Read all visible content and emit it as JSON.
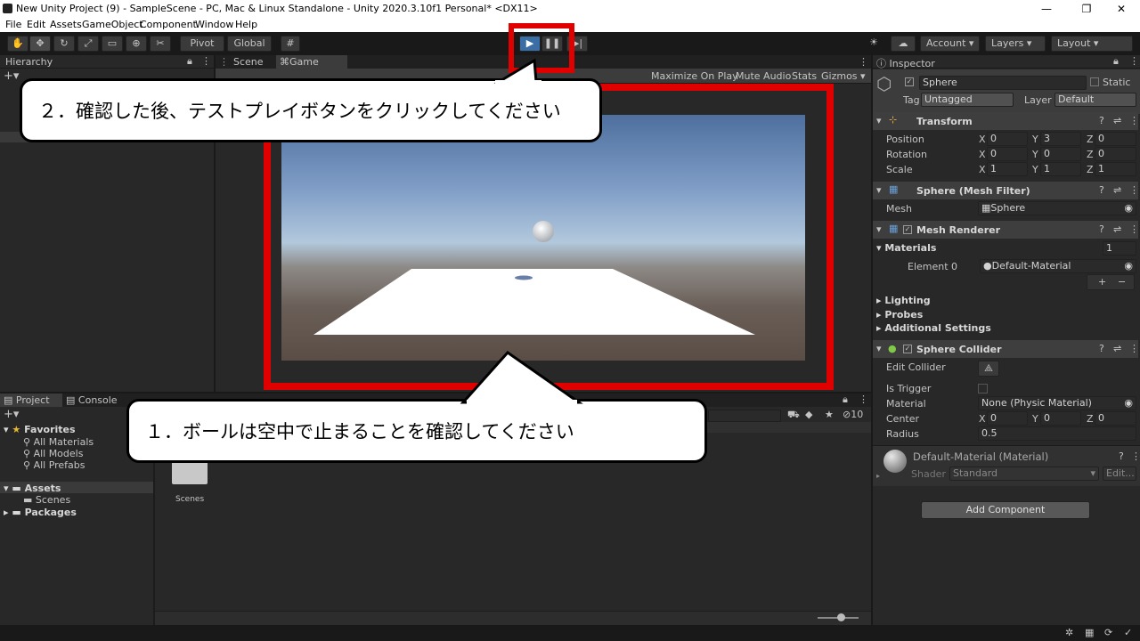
{
  "window": {
    "title": "New Unity Project (9) - SampleScene - PC, Mac & Linux Standalone - Unity 2020.3.10f1 Personal* <DX11>",
    "minimize": "—",
    "maximize": "❐",
    "close": "✕"
  },
  "menu": [
    "File",
    "Edit",
    "Assets",
    "GameObject",
    "Component",
    "Window",
    "Help"
  ],
  "toolbar": {
    "pivot": "Pivot",
    "global": "Global",
    "account": "Account",
    "layers": "Layers",
    "layout": "Layout"
  },
  "hierarchy": {
    "tab": "Hierarchy"
  },
  "scene_tabs": {
    "scene": "Scene",
    "game": "Game"
  },
  "game_toolbar": {
    "maximize": "Maximize On Play",
    "mute": "Mute Audio",
    "stats": "Stats",
    "gizmos": "Gizmos"
  },
  "project": {
    "tab_project": "Project",
    "tab_console": "Console",
    "favorites": "Favorites",
    "fav_items": [
      "All Materials",
      "All Models",
      "All Prefabs"
    ],
    "assets": "Assets",
    "scenes": "Scenes",
    "packages": "Packages",
    "folder_label": "Scenes",
    "count": "10"
  },
  "inspector": {
    "tab": "Inspector",
    "object_name": "Sphere",
    "static": "Static",
    "tag_label": "Tag",
    "tag_value": "Untagged",
    "layer_label": "Layer",
    "layer_value": "Default",
    "transform": {
      "title": "Transform",
      "position": {
        "label": "Position",
        "x": "0",
        "y": "3",
        "z": "0"
      },
      "rotation": {
        "label": "Rotation",
        "x": "0",
        "y": "0",
        "z": "0"
      },
      "scale": {
        "label": "Scale",
        "x": "1",
        "y": "1",
        "z": "1"
      }
    },
    "mesh_filter": {
      "title": "Sphere (Mesh Filter)",
      "mesh_label": "Mesh",
      "mesh_value": "Sphere"
    },
    "mesh_renderer": {
      "title": "Mesh Renderer",
      "materials": "Materials",
      "materials_count": "1",
      "element0": "Element 0",
      "element0_value": "Default-Material",
      "lighting": "Lighting",
      "probes": "Probes",
      "additional": "Additional Settings"
    },
    "sphere_collider": {
      "title": "Sphere Collider",
      "edit_collider": "Edit Collider",
      "is_trigger": "Is Trigger",
      "material_label": "Material",
      "material_value": "None (Physic Material)",
      "center_label": "Center",
      "cx": "0",
      "cy": "0",
      "cz": "0",
      "radius_label": "Radius",
      "radius_value": "0.5"
    },
    "material": {
      "title": "Default-Material (Material)",
      "shader_label": "Shader",
      "shader_value": "Standard",
      "edit": "Edit..."
    },
    "add_component": "Add Component"
  },
  "callouts": {
    "step2": "２．確認した後、テストプレイボタンをクリックしてください",
    "step1": "１．ボールは空中で止まることを確認してください"
  },
  "colors": {
    "highlight": "#e00000",
    "play_active": "#3a6ea5"
  }
}
